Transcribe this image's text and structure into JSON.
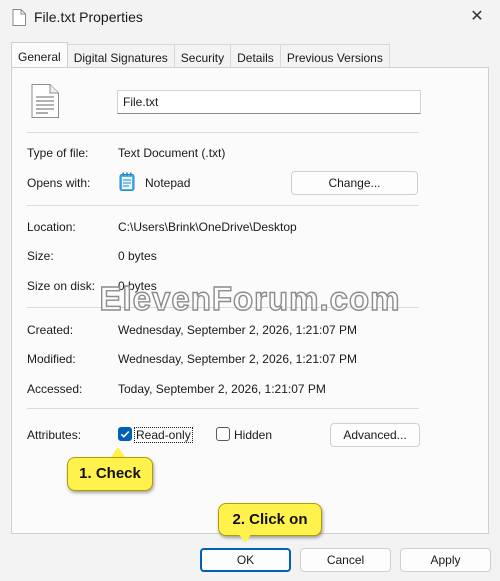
{
  "window": {
    "title": "File.txt Properties",
    "close_glyph": "✕"
  },
  "tabs": [
    {
      "label": "General",
      "active": true
    },
    {
      "label": "Digital Signatures",
      "active": false
    },
    {
      "label": "Security",
      "active": false
    },
    {
      "label": "Details",
      "active": false
    },
    {
      "label": "Previous Versions",
      "active": false
    }
  ],
  "general": {
    "file_icon": "text-file-icon",
    "file_name": "File.txt",
    "type_label": "Type of file:",
    "type_value": "Text Document (.txt)",
    "opens_label": "Opens with:",
    "opens_icon": "notepad-icon",
    "opens_value": "Notepad",
    "change_button": "Change...",
    "location_label": "Location:",
    "location_value": "C:\\Users\\Brink\\OneDrive\\Desktop",
    "size_label": "Size:",
    "size_value": "0 bytes",
    "size_on_disk_label": "Size on disk:",
    "size_on_disk_value": "0 bytes",
    "created_label": "Created:",
    "created_value": "Wednesday, September 2, 2026, 1:21:07 PM",
    "modified_label": "Modified:",
    "modified_value": "Wednesday, September 2, 2026, 1:21:07 PM",
    "accessed_label": "Accessed:",
    "accessed_value": "Today, September 2, 2026, 1:21:07 PM",
    "attributes_label": "Attributes:",
    "readonly_label": "Read-only",
    "readonly_checked": true,
    "hidden_label": "Hidden",
    "hidden_checked": false,
    "advanced_button": "Advanced..."
  },
  "watermark": "ElevenForum.com",
  "callouts": {
    "check": "1. Check",
    "click": "2. Click on"
  },
  "footer": {
    "ok": "OK",
    "cancel": "Cancel",
    "apply": "Apply"
  },
  "colors": {
    "accent": "#005fb8",
    "callout": "#fff24d"
  }
}
